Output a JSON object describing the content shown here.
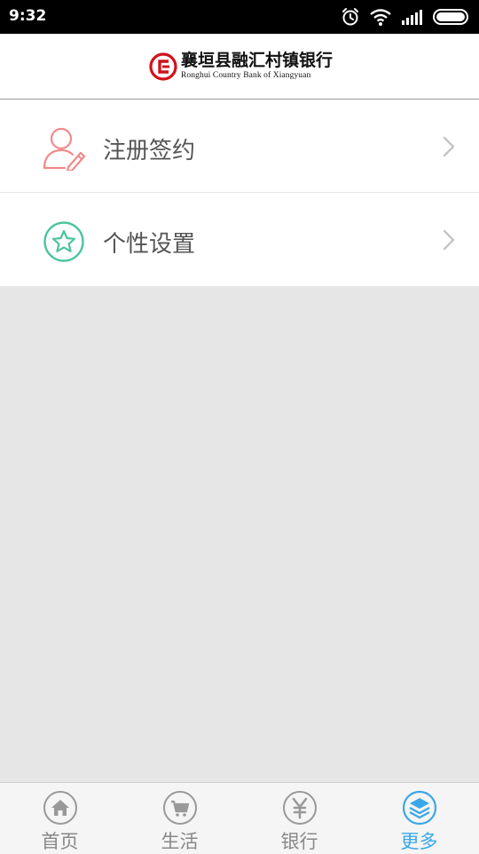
{
  "status_bar": {
    "time": "9:32",
    "icons": [
      "alarm-icon",
      "wifi-icon",
      "signal-icon",
      "battery-icon"
    ]
  },
  "header": {
    "brand_name_cn": "襄垣县融汇村镇银行",
    "brand_name_en": "Ronghui Country Bank of Xiangyuan",
    "logo_color": "#d0121b"
  },
  "menu": {
    "items": [
      {
        "label": "注册签约",
        "icon": "user-edit-icon",
        "color": "#f08a8a"
      },
      {
        "label": "个性设置",
        "icon": "star-icon",
        "color": "#4cc3a0"
      }
    ]
  },
  "tabbar": {
    "items": [
      {
        "label": "首页",
        "icon": "home-icon",
        "active": false
      },
      {
        "label": "生活",
        "icon": "cart-icon",
        "active": false
      },
      {
        "label": "银行",
        "icon": "yuan-icon",
        "active": false
      },
      {
        "label": "更多",
        "icon": "layers-icon",
        "active": true
      }
    ],
    "active_color": "#3aa7e8",
    "inactive_color": "#888888"
  }
}
